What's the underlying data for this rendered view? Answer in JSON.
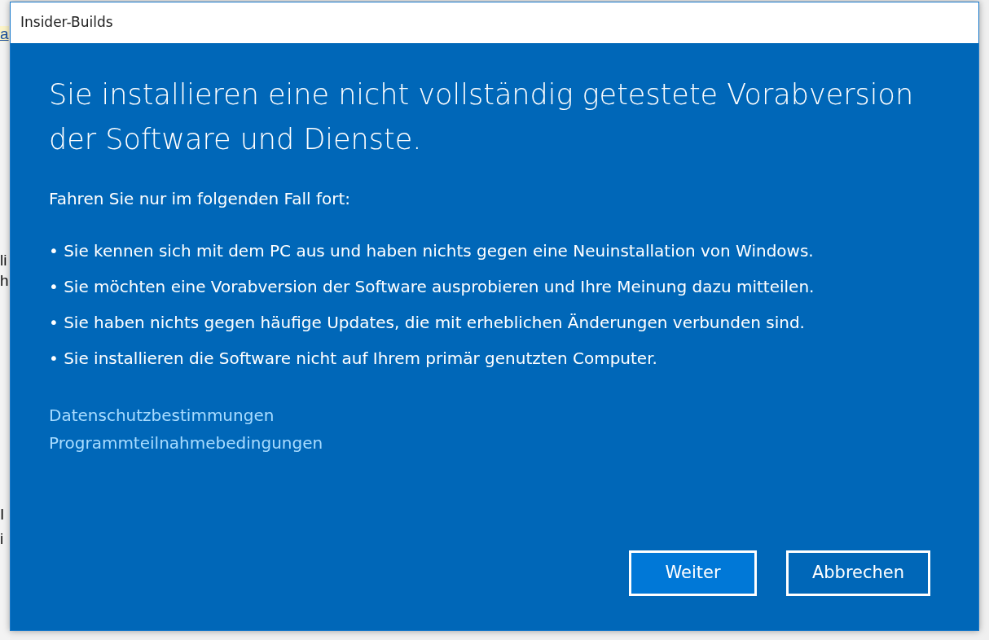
{
  "background": {
    "fragments": [
      {
        "text": "a",
        "kind": "link"
      },
      {
        "text": "li",
        "kind": "plain"
      },
      {
        "text": "h",
        "kind": "plain"
      },
      {
        "text": "I",
        "kind": "plain"
      },
      {
        "text": "i",
        "kind": "plain"
      }
    ]
  },
  "window": {
    "title": "Insider-Builds"
  },
  "dialog": {
    "heading": "Sie installieren eine nicht vollständig getestete Vorabversion der Software und Dienste.",
    "intro": "Fahren Sie nur im folgenden Fall fort:",
    "bullets": [
      "• Sie kennen sich mit dem PC aus und haben nichts gegen eine Neuinstallation von Windows.",
      "• Sie möchten eine Vorabversion der Software ausprobieren und Ihre Meinung dazu mitteilen.",
      "• Sie haben nichts gegen häufige Updates, die mit erheblichen Änderungen verbunden sind.",
      "• Sie installieren die Software nicht auf Ihrem primär genutzten Computer."
    ],
    "links": [
      "Datenschutzbestimmungen",
      "Programmteilnahmebedingungen"
    ],
    "buttons": [
      {
        "label": "Weiter",
        "kind": "primary"
      },
      {
        "label": "Abbrechen",
        "kind": "secondary"
      }
    ]
  }
}
